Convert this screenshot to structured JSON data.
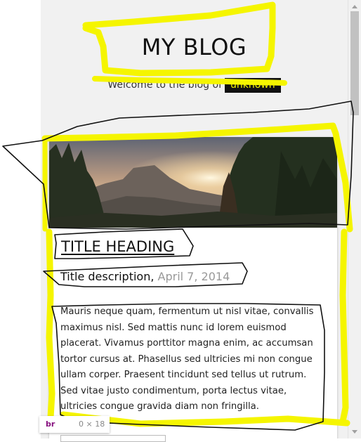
{
  "header": {
    "title": "MY BLOG",
    "welcome": "Welcome to the blog of",
    "author": "unknown"
  },
  "post": {
    "title": "TITLE HEADING",
    "description": "Title description,",
    "date": "April 7, 2014",
    "body": "Mauris neque quam, fermentum ut nisl vitae, convallis maximus nisl. Sed mattis nunc id lorem euismod placerat. Vivamus porttitor magna enim, ac accumsan tortor cursus at. Phasellus sed ultricies mi non congue ullam corper. Praesent tincidunt sed tellus ut rutrum. Sed vitae justo condimentum, porta lectus vitae, ultricies congue gravida diam non fringilla."
  },
  "devtools_tooltip": {
    "tag": "br",
    "size": "0 × 18"
  },
  "colors": {
    "highlight_yellow": "#f5f500",
    "pen_black": "#111111",
    "page_background": "#f1f1f1"
  },
  "icons": [
    "scroll-up-arrow-icon",
    "scroll-down-arrow-icon"
  ]
}
